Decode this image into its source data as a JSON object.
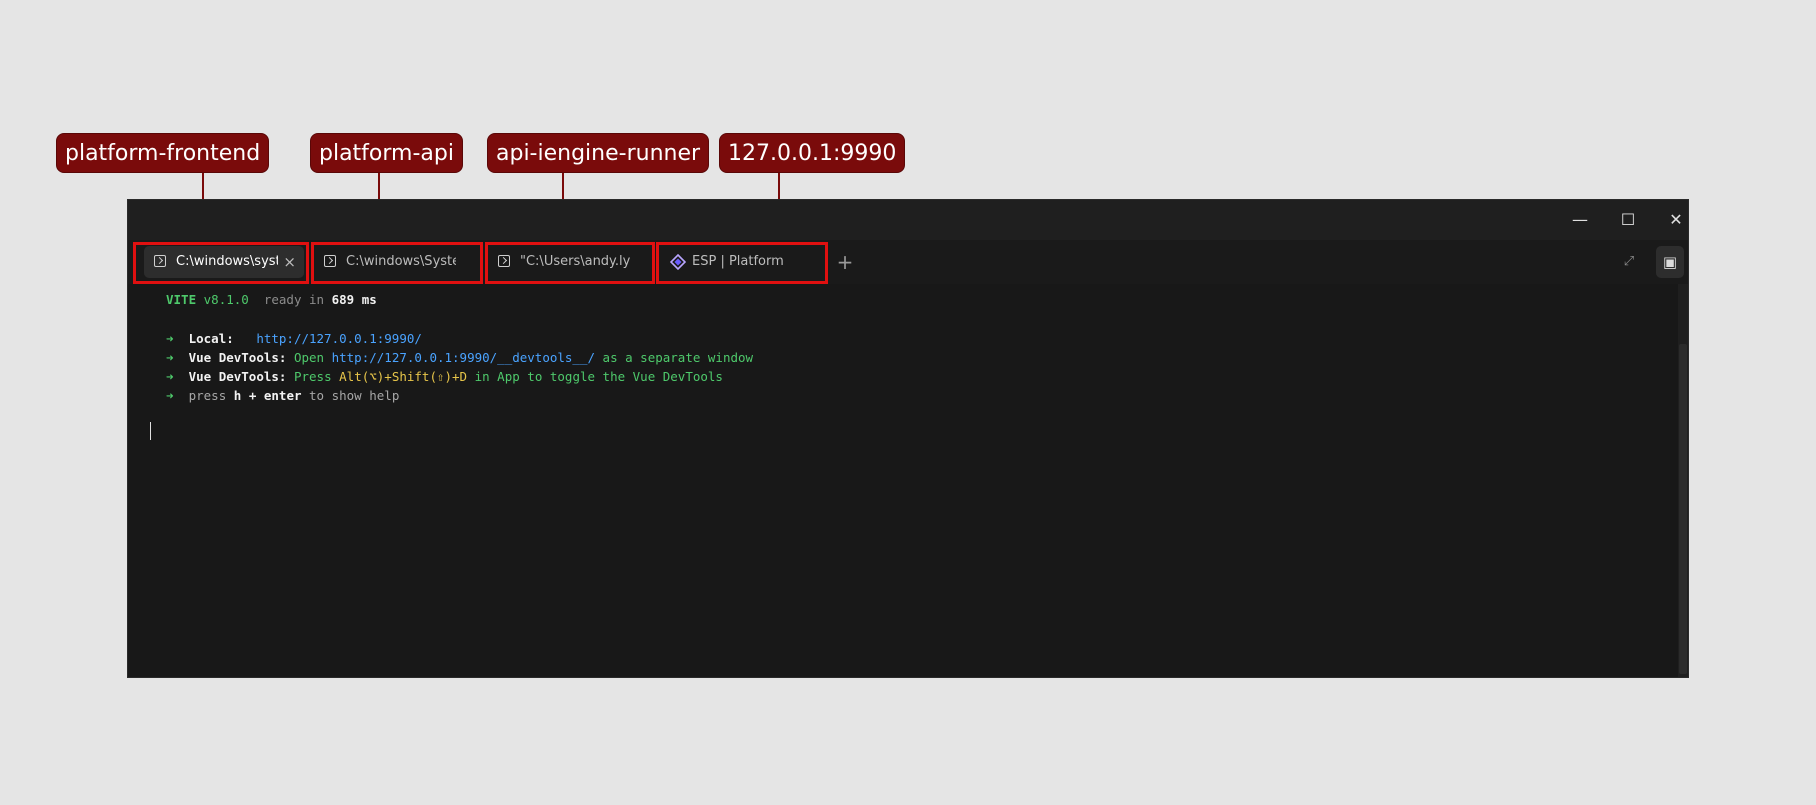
{
  "callouts": [
    {
      "label": "platform-frontend"
    },
    {
      "label": "platform-api"
    },
    {
      "label": "api-iengine-runner"
    },
    {
      "label": "127.0.0.1:9990"
    }
  ],
  "window": {
    "controls": {
      "minimize": "—",
      "maximize": "☐",
      "close": "✕"
    }
  },
  "tabs": [
    {
      "label": "C:\\windows\\syst",
      "icon": "terminal-icon",
      "active": true
    },
    {
      "label": "C:\\windows\\System",
      "icon": "terminal-icon",
      "active": false
    },
    {
      "label": "\"C:\\Users\\andy.lyell",
      "icon": "terminal-icon",
      "active": false
    },
    {
      "label": "ESP | Platform",
      "icon": "esp-diamond-icon",
      "active": false
    }
  ],
  "tabbar": {
    "new_tab": "+",
    "close_tab": "×",
    "expand_icon": "⤢",
    "panel_icon": "▣"
  },
  "terminal": {
    "vite_name": "VITE",
    "vite_version": "v8.1.0",
    "ready_text": "ready in",
    "ready_ms": "689",
    "ms_unit": "ms",
    "arrow": "➜",
    "local_label": "Local:",
    "local_url": "http://127.0.0.1:9990/",
    "devtools_label": "Vue DevTools:",
    "devtools1_open": "Open",
    "devtools1_url": "http://127.0.0.1:9990/__devtools__/",
    "devtools1_rest": "as a separate window",
    "devtools2_press": "Press",
    "devtools2_keys": "Alt(⌥)+Shift(⇧)+D",
    "devtools2_rest": "in App to toggle the Vue DevTools",
    "help_press": "press",
    "help_keys": "h + enter",
    "help_rest": "to show help"
  },
  "colors": {
    "callout_bg": "#7a0b0b",
    "highlight": "#e01010",
    "terminal_bg": "#181818",
    "green": "#4ec96b",
    "blue": "#4aa3ff",
    "yellow": "#e8c64a"
  }
}
